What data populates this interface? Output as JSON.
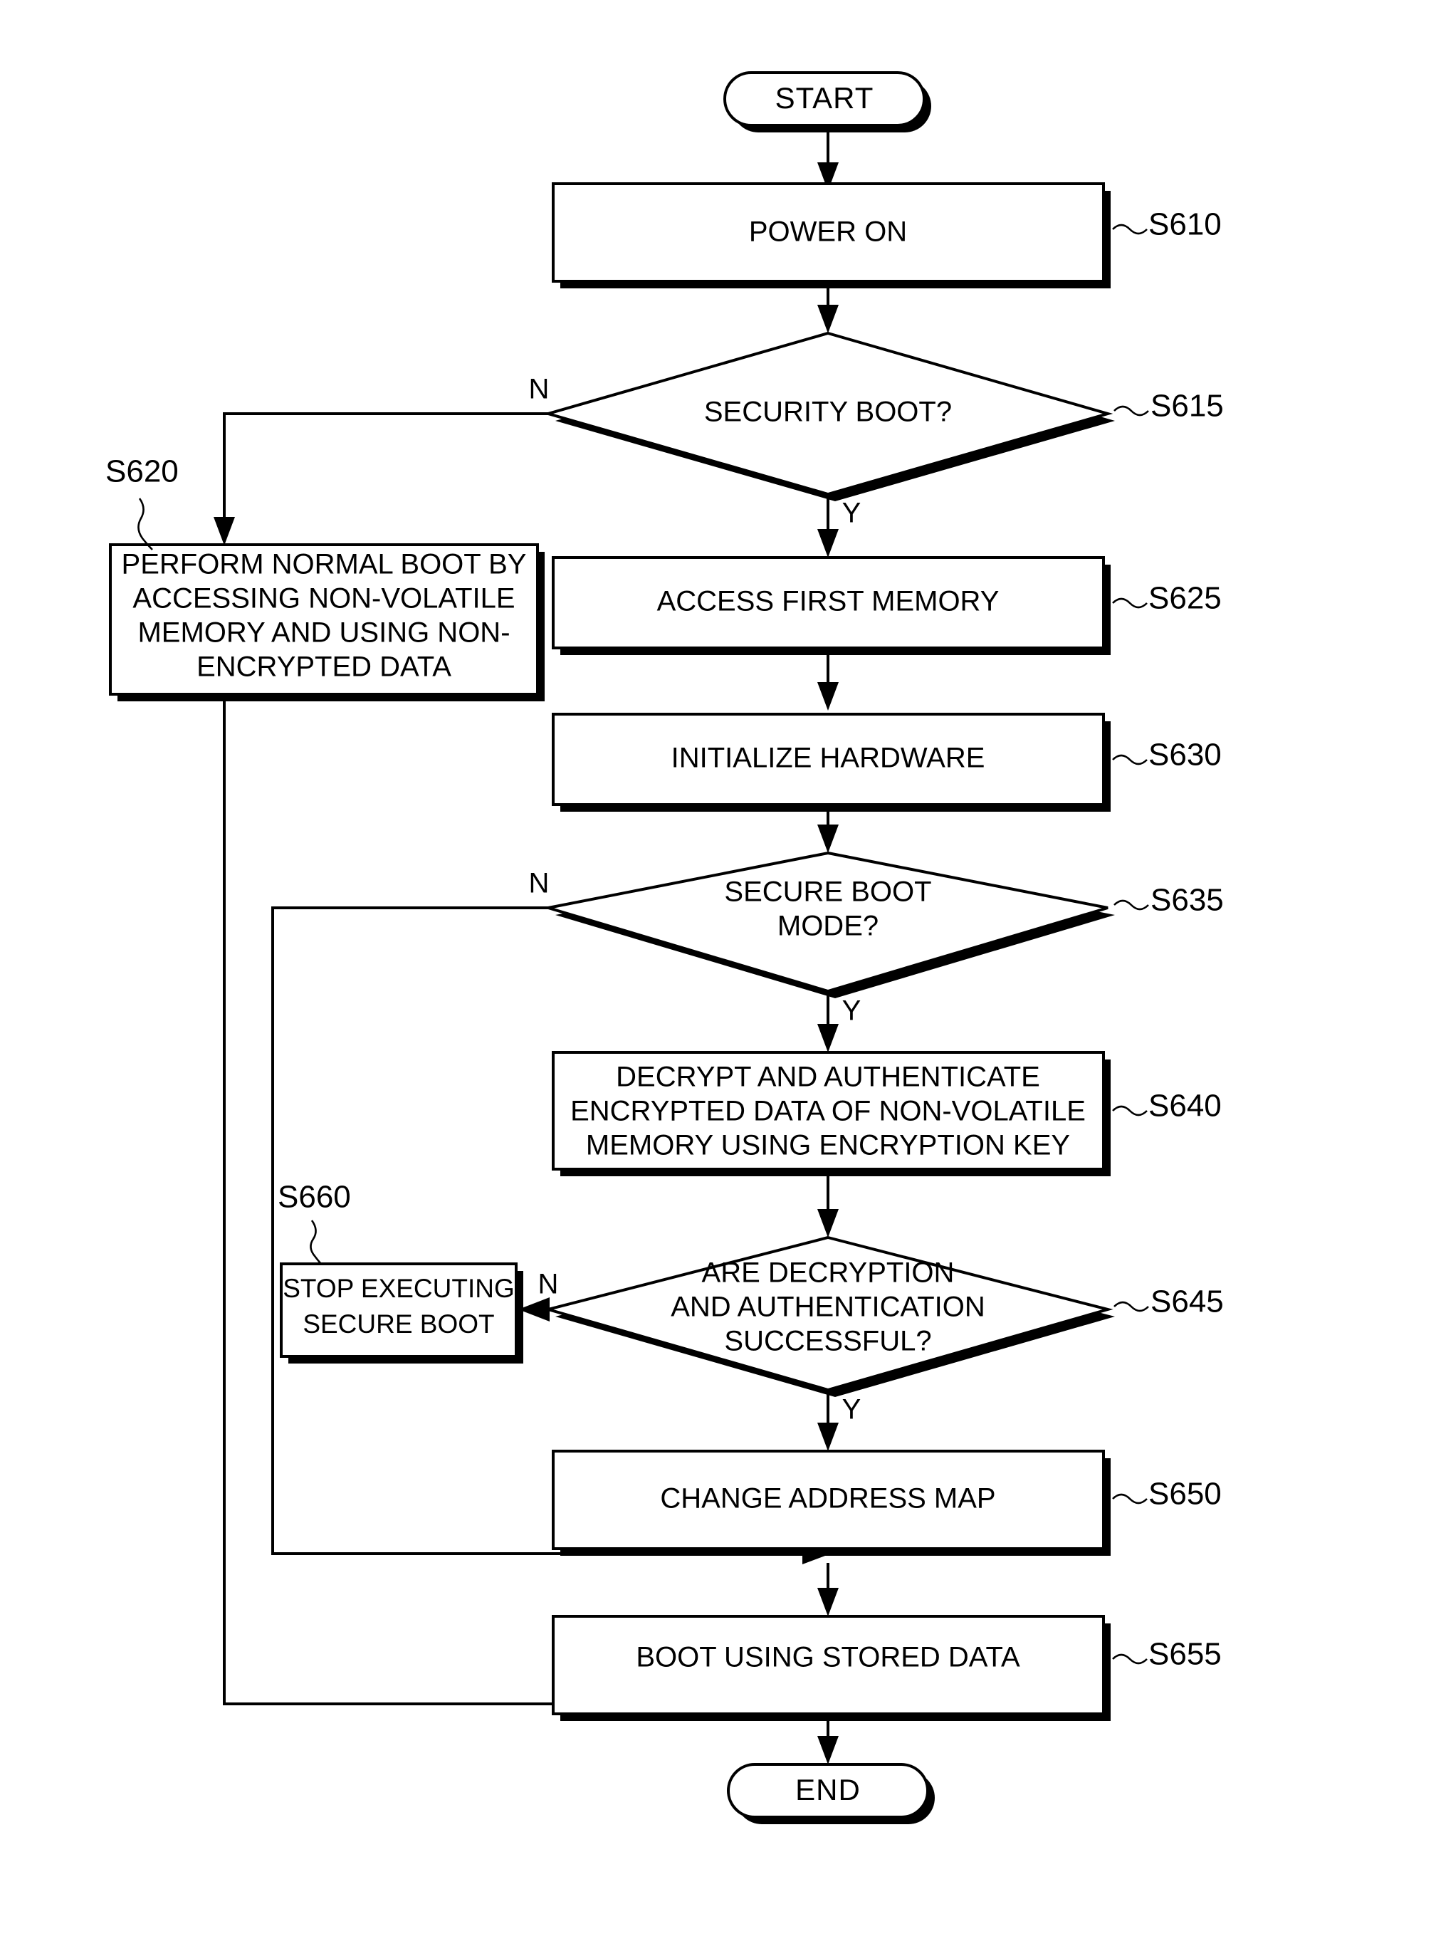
{
  "figure": {
    "type": "flowchart",
    "title": "Secure boot process flowchart"
  },
  "nodes": {
    "start": {
      "label": "START",
      "shape": "terminator"
    },
    "end": {
      "label": "END",
      "shape": "terminator"
    },
    "s610": {
      "step": "S610",
      "label": "POWER ON",
      "shape": "process"
    },
    "s615": {
      "step": "S615",
      "label": "SECURITY BOOT?",
      "shape": "decision"
    },
    "s620": {
      "step": "S620",
      "shape": "process",
      "line1": "PERFORM NORMAL BOOT BY",
      "line2": "ACCESSING NON-VOLATILE",
      "line3": "MEMORY AND USING NON-",
      "line4": "ENCRYPTED DATA"
    },
    "s625": {
      "step": "S625",
      "label": "ACCESS FIRST MEMORY",
      "shape": "process"
    },
    "s630": {
      "step": "S630",
      "label": "INITIALIZE HARDWARE",
      "shape": "process"
    },
    "s635": {
      "step": "S635",
      "shape": "decision",
      "line1": "SECURE BOOT",
      "line2": "MODE?"
    },
    "s640": {
      "step": "S640",
      "shape": "process",
      "line1": "DECRYPT AND AUTHENTICATE",
      "line2": "ENCRYPTED DATA OF NON-VOLATILE",
      "line3": "MEMORY USING ENCRYPTION KEY"
    },
    "s645": {
      "step": "S645",
      "shape": "decision",
      "line1": "ARE DECRYPTION",
      "line2": "AND AUTHENTICATION",
      "line3": "SUCCESSFUL?"
    },
    "s650": {
      "step": "S650",
      "label": "CHANGE ADDRESS MAP",
      "shape": "process"
    },
    "s655": {
      "step": "S655",
      "label": "BOOT USING STORED DATA",
      "shape": "process"
    },
    "s660": {
      "step": "S660",
      "shape": "process",
      "line1": "STOP EXECUTING",
      "line2": "SECURE BOOT"
    }
  },
  "branch_labels": {
    "s615_no": "N",
    "s615_yes": "Y",
    "s635_no": "N",
    "s635_yes": "Y",
    "s645_no": "N",
    "s645_yes": "Y"
  },
  "colors": {
    "stroke": "#000000",
    "fill": "#ffffff",
    "background": "#ffffff"
  }
}
